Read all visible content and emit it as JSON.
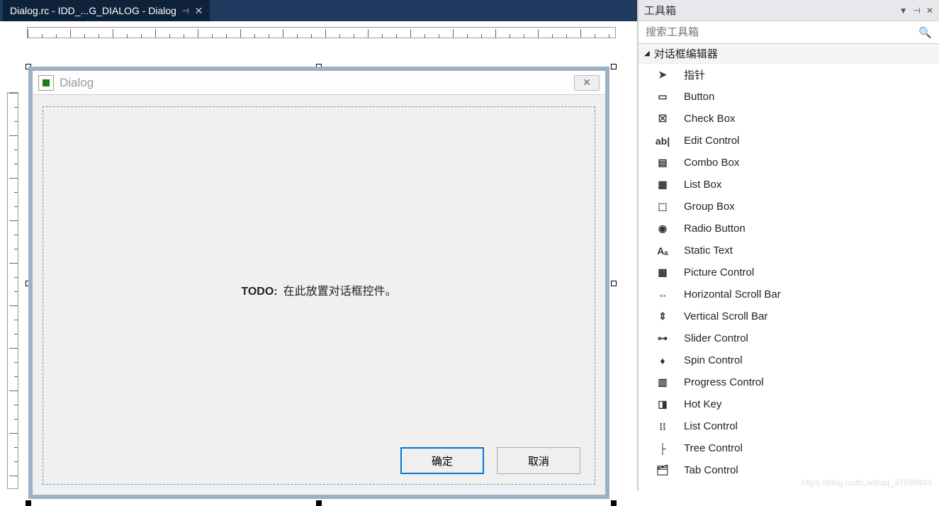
{
  "tab": {
    "title": "Dialog.rc - IDD_...G_DIALOG - Dialog"
  },
  "dialog": {
    "title": "Dialog",
    "todo_label": "TODO:",
    "todo_text": "在此放置对话框控件。",
    "ok": "确定",
    "cancel": "取消"
  },
  "toolbox": {
    "title": "工具箱",
    "search_placeholder": "搜索工具箱",
    "group": "对话框编辑器",
    "items": [
      {
        "label": "指针",
        "icon": "pointer"
      },
      {
        "label": "Button",
        "icon": "button"
      },
      {
        "label": "Check Box",
        "icon": "checkbox"
      },
      {
        "label": "Edit Control",
        "icon": "edit"
      },
      {
        "label": "Combo Box",
        "icon": "combo"
      },
      {
        "label": "List Box",
        "icon": "listbox"
      },
      {
        "label": "Group Box",
        "icon": "groupbox"
      },
      {
        "label": "Radio Button",
        "icon": "radio"
      },
      {
        "label": "Static Text",
        "icon": "static"
      },
      {
        "label": "Picture Control",
        "icon": "picture"
      },
      {
        "label": "Horizontal Scroll Bar",
        "icon": "hscroll"
      },
      {
        "label": "Vertical Scroll Bar",
        "icon": "vscroll"
      },
      {
        "label": "Slider Control",
        "icon": "slider"
      },
      {
        "label": "Spin Control",
        "icon": "spin"
      },
      {
        "label": "Progress Control",
        "icon": "progress"
      },
      {
        "label": "Hot Key",
        "icon": "hotkey"
      },
      {
        "label": "List Control",
        "icon": "listctrl"
      },
      {
        "label": "Tree Control",
        "icon": "tree"
      },
      {
        "label": "Tab Control",
        "icon": "tab"
      }
    ]
  },
  "watermark": "https://blog.csdn.net/qq_37596943"
}
